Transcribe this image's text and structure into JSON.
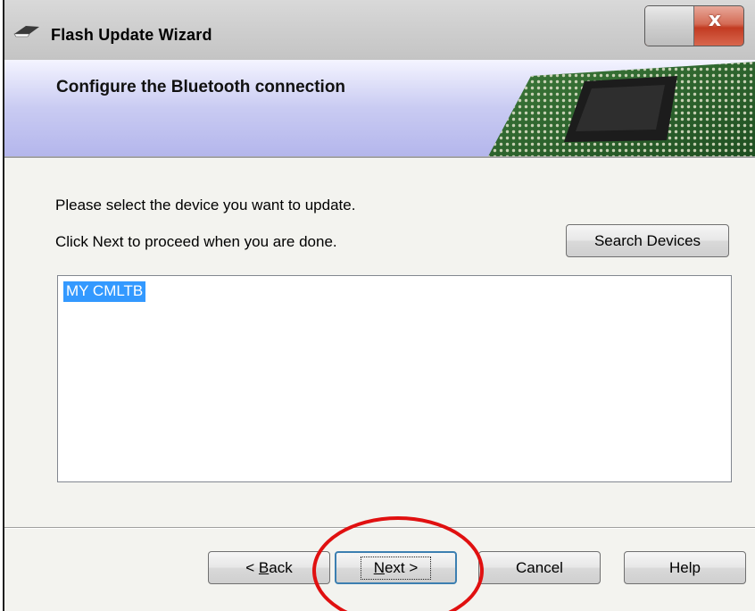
{
  "window": {
    "title": "Flash Update Wizard",
    "close_glyph": "x"
  },
  "banner": {
    "title": "Configure the Bluetooth connection"
  },
  "instructions": {
    "line1": "Please select the device you want to update.",
    "line2": "Click Next to proceed when you are done."
  },
  "search_button": {
    "label": "Search Devices"
  },
  "device_list": {
    "items": [
      "MY CMLTB"
    ],
    "selected_index": 0
  },
  "footer": {
    "back": {
      "prefix": "< ",
      "mnemonic": "B",
      "rest": "ack"
    },
    "next": {
      "mnemonic": "N",
      "rest": "ext",
      "suffix": " >"
    },
    "cancel": "Cancel",
    "help": "Help"
  },
  "colors": {
    "selection": "#3399ff",
    "banner": "#b4b6ec",
    "annotation_circle": "#e01010"
  },
  "icons": {
    "title_icon": "wizard-app-icon",
    "close": "close-icon",
    "banner_art": "chip-illustration"
  }
}
